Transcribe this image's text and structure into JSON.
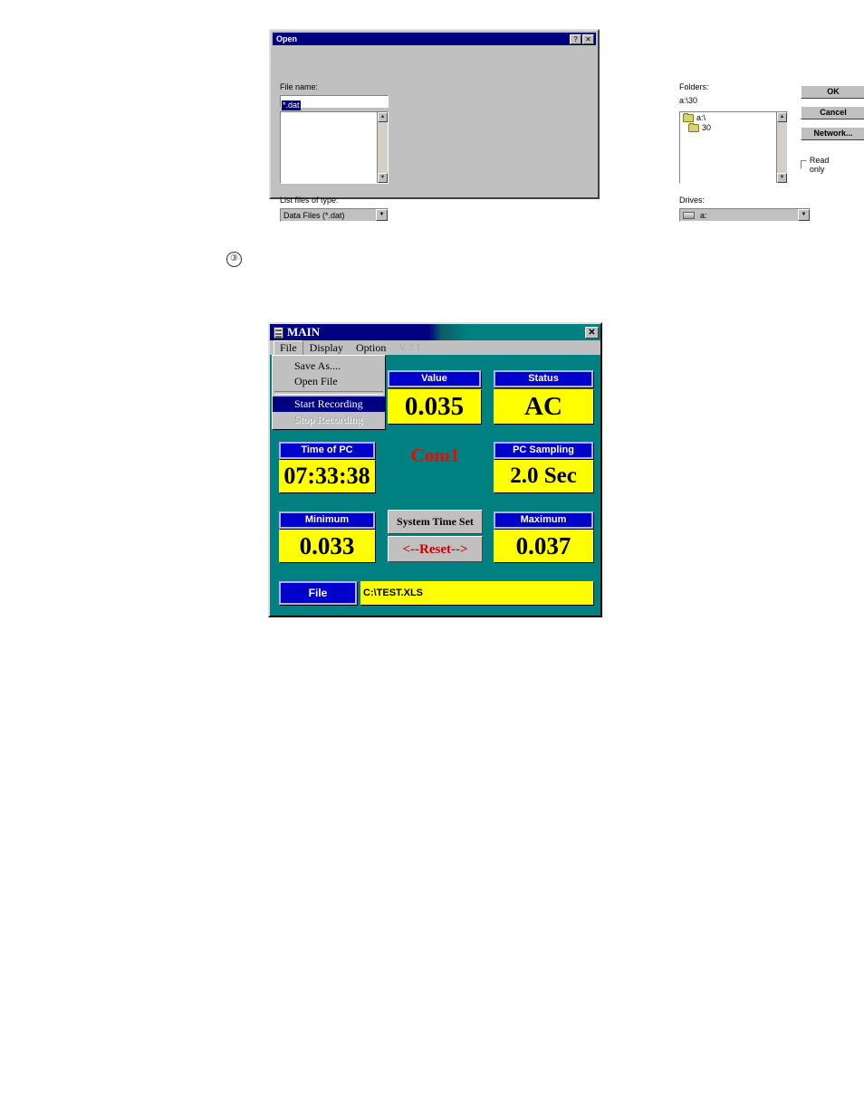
{
  "open_dialog": {
    "title": "Open",
    "help_button": "?",
    "close_button": "✕",
    "file_name_label": "File name:",
    "file_name_value": "*.dat",
    "folders_label": "Folders:",
    "folders_path": "a:\\30",
    "folder_items": [
      {
        "name": "a:\\",
        "indent": false
      },
      {
        "name": "30",
        "indent": true
      }
    ],
    "file_items": [],
    "buttons": {
      "ok": "OK",
      "cancel": "Cancel",
      "network": "Network..."
    },
    "read_only_label": "Read only",
    "read_only_checked": false,
    "list_files_label": "List files of type:",
    "list_files_value": "Data Files (*.dat)",
    "drives_label": "Drives:",
    "drives_value": "a:",
    "dropdown_arrow": "▼",
    "scroll_up": "▲",
    "scroll_down": "▼"
  },
  "marker": {
    "step_number": "③"
  },
  "main_window": {
    "title": "MAIN",
    "close_button": "✕",
    "menubar": [
      {
        "label": "File",
        "active": true
      },
      {
        "label": "Display",
        "active": false
      },
      {
        "label": "Option",
        "active": false
      }
    ],
    "version": "V 2.1",
    "file_menu": [
      {
        "label": "Save As....",
        "state": "normal"
      },
      {
        "label": "Open File",
        "state": "normal"
      },
      {
        "label": "Start Recording",
        "state": "selected"
      },
      {
        "label": "Stop Recording",
        "state": "disabled"
      }
    ],
    "panels": {
      "value": {
        "label": "Value",
        "value": "0.035"
      },
      "status": {
        "label": "Status",
        "value": "AC"
      },
      "time_of_pc": {
        "label": "Time of PC",
        "value": "07:33:38"
      },
      "pc_sampling": {
        "label": "PC Sampling",
        "value": "2.0 Sec"
      },
      "minimum": {
        "label": "Minimum",
        "value": "0.033"
      },
      "maximum": {
        "label": "Maximum",
        "value": "0.037"
      }
    },
    "com_port": "Com1",
    "system_time_set_button": "System Time Set",
    "reset_button": "<--Reset-->",
    "file_button": "File",
    "file_path": "C:\\TEST.XLS"
  },
  "colors": {
    "panel_label_bg": "#0000cc",
    "panel_value_bg": "#ffff00",
    "window_bg": "#008080",
    "titlebar_bg": "#000080",
    "com_text": "#ff0000",
    "reset_text": "#cc0000"
  }
}
